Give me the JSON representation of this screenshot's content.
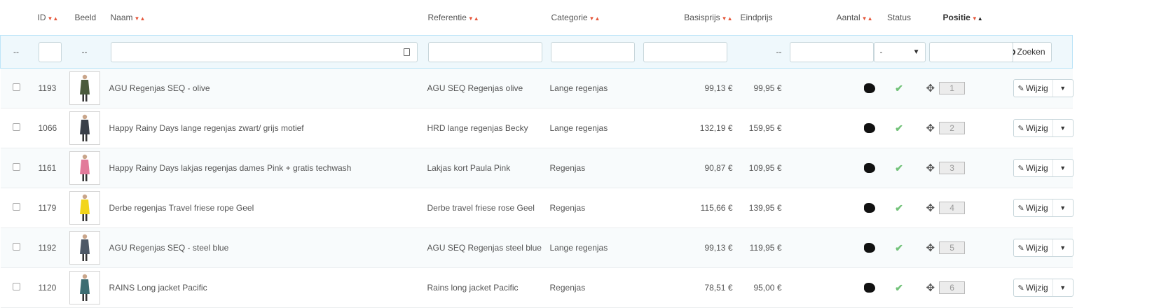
{
  "columns": {
    "id": "ID",
    "image": "Beeld",
    "name": "Naam",
    "reference": "Referentie",
    "category": "Categorie",
    "base_price": "Basisprijs",
    "final_price": "Eindprijs",
    "quantity": "Aantal",
    "status": "Status",
    "position": "Positie"
  },
  "filters": {
    "checkbox_placeholder": "--",
    "image_placeholder": "--",
    "final_price_placeholder": "--",
    "status_value": "-",
    "search_button": "Zoeken"
  },
  "rows": [
    {
      "id": "1193",
      "name": "AGU Regenjas SEQ - olive",
      "reference": "AGU SEQ Regenjas olive",
      "category": "Lange regenjas",
      "base_price": "99,13 €",
      "final_price": "99,95 €",
      "position": "1",
      "edit": "Wijzig",
      "thumb_color": "#4a5a3c"
    },
    {
      "id": "1066",
      "name": "Happy Rainy Days lange regenjas zwart/ grijs motief",
      "reference": "HRD lange regenjas Becky",
      "category": "Lange regenjas",
      "base_price": "132,19 €",
      "final_price": "159,95 €",
      "position": "2",
      "edit": "Wijzig",
      "thumb_color": "#3a3f48"
    },
    {
      "id": "1161",
      "name": "Happy Rainy Days lakjas regenjas dames Pink + gratis techwash",
      "reference": "Lakjas kort Paula Pink",
      "category": "Regenjas",
      "base_price": "90,87 €",
      "final_price": "109,95 €",
      "position": "3",
      "edit": "Wijzig",
      "thumb_color": "#e27a9a"
    },
    {
      "id": "1179",
      "name": "Derbe regenjas Travel friese rope Geel",
      "reference": "Derbe travel friese rose Geel",
      "category": "Regenjas",
      "base_price": "115,66 €",
      "final_price": "139,95 €",
      "position": "4",
      "edit": "Wijzig",
      "thumb_color": "#f2d51a"
    },
    {
      "id": "1192",
      "name": "AGU Regenjas SEQ - steel blue",
      "reference": "AGU SEQ Regenjas steel blue",
      "category": "Lange regenjas",
      "base_price": "99,13 €",
      "final_price": "119,95 €",
      "position": "5",
      "edit": "Wijzig",
      "thumb_color": "#4d5866"
    },
    {
      "id": "1120",
      "name": "RAINS Long jacket Pacific",
      "reference": "Rains long jacket Pacific",
      "category": "Regenjas",
      "base_price": "78,51 €",
      "final_price": "95,00 €",
      "position": "6",
      "edit": "Wijzig",
      "thumb_color": "#3d6d72"
    }
  ]
}
